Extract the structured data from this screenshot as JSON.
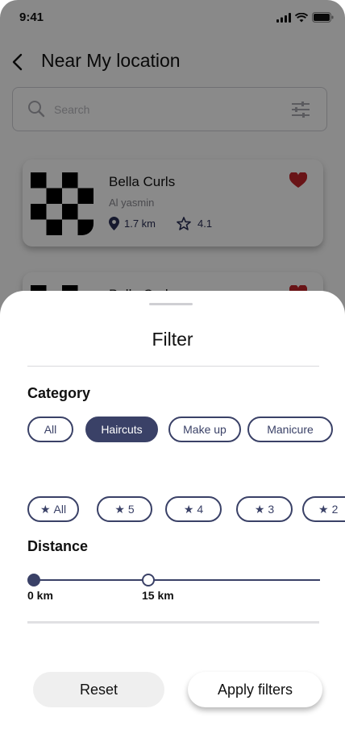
{
  "status_bar": {
    "time": "9:41"
  },
  "header": {
    "title": "Near My location",
    "back_icon": "chevron-left-icon"
  },
  "search": {
    "placeholder": "Search",
    "icon": "search-icon",
    "filter_icon": "sliders-icon"
  },
  "salons": [
    {
      "name": "Bella Curls",
      "area": "Al yasmin",
      "distance": "1.7 km",
      "rating": "4.1",
      "favorite": true
    },
    {
      "name": "Bella Curls",
      "area": "",
      "distance": "",
      "rating": "",
      "favorite": true
    }
  ],
  "filter": {
    "title": "Filter",
    "category": {
      "title": "Category",
      "options": [
        "All",
        "Haircuts",
        "Make up",
        "Manicure"
      ],
      "selected": "Haircuts"
    },
    "rating": {
      "star_glyph": "★",
      "options": [
        "All",
        "5",
        "4",
        "3",
        "2"
      ]
    },
    "distance": {
      "title": "Distance",
      "min_label": "0 km",
      "max_label": "15 km"
    },
    "buttons": {
      "reset": "Reset",
      "apply": "Apply filters"
    }
  },
  "colors": {
    "accent": "#3a4167",
    "favorite": "#c3262c",
    "overlay": "rgba(0,0,0,0.46)"
  }
}
